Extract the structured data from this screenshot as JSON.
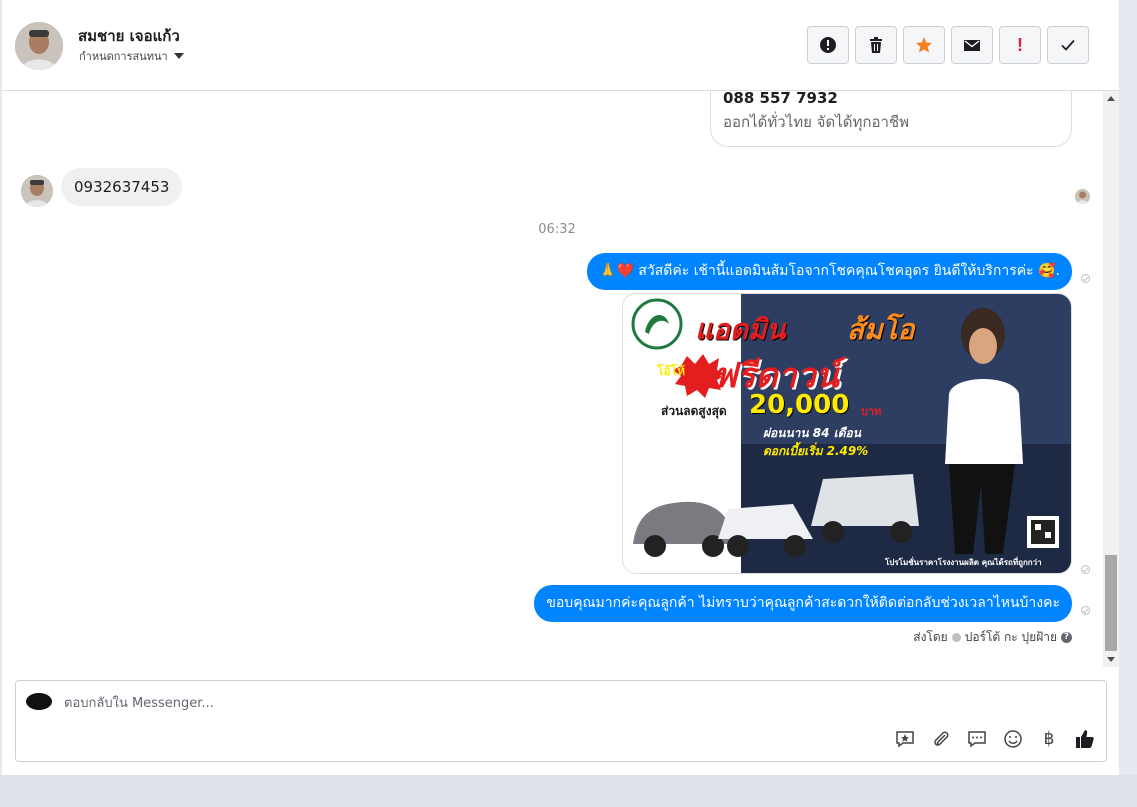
{
  "contact": {
    "name": "สมชาย เจอแก้ว",
    "assign_label": "กำหนดการสนทนา"
  },
  "toolbar": {
    "icons": [
      "warning-icon",
      "trash-icon",
      "star-icon",
      "mail-icon",
      "exclamation-icon",
      "check-icon"
    ],
    "star_color": "#f5821f",
    "exclamation_color": "#e41e3f",
    "exclamation_label": "!"
  },
  "thread": {
    "card": {
      "phone": "088 557 7932",
      "subtitle": "ออกได้ทั่วไทย จัดได้ทุกอาชีพ"
    },
    "incoming_message": "0932637453",
    "timestamp": "06:32",
    "outgoing_greeting": "🙏❤️ สวัสดีค่ะ เช้านี้แอดมินส้มโอจากโชคคุณโชคอุดร ยินดีให้บริการค่ะ 🥰.",
    "promo_image": {
      "title_admin": "แอดมิน",
      "title_name": "ส้มโอ",
      "badge": "โอ้โห้",
      "headline": "ฟรีดาวน์",
      "discount_label": "ส่วนลดสูงสุด",
      "discount_value": "20,000",
      "discount_unit": "บาท",
      "installment": "ผ่อนนาน 84 เดือน",
      "interest": "ดอกเบี้ยเริ่ม 2.49%",
      "footer": "โปรโมชั่นราคาโรงงานผลิต คุณได้รถที่ถูกกว่า"
    },
    "outgoing_thanks": "ขอบคุณมากค่ะคุณลูกค้า ไม่ทราบว่าคุณลูกค้าสะดวกให้ติดต่อกลับช่วงเวลาไหนบ้างคะ",
    "sent_by_prefix": "ส่งโดย",
    "sent_by_name": "ปอร์โต้ กะ ปุยฝ้าย",
    "help_mark": "?"
  },
  "composer": {
    "placeholder": "ตอบกลับใน Messenger...",
    "tools": [
      "saved-reply-icon",
      "attachment-icon",
      "quick-reply-icon",
      "emoji-icon",
      "baht-icon",
      "thumbs-up-icon"
    ],
    "baht_symbol": "฿"
  },
  "colors": {
    "accent": "#0084ff",
    "incoming_bubble": "#f0f0f0"
  }
}
